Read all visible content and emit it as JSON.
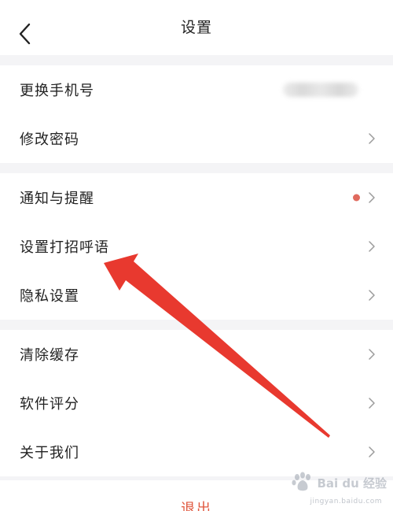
{
  "header": {
    "title": "设置",
    "back_icon": "chevron-left-icon"
  },
  "groups": [
    {
      "items": [
        {
          "label": "更换手机号",
          "value_blurred": true
        },
        {
          "label": "修改密码"
        }
      ]
    },
    {
      "items": [
        {
          "label": "通知与提醒",
          "badge": "red-dot"
        },
        {
          "label": "设置打招呼语"
        },
        {
          "label": "隐私设置"
        }
      ]
    },
    {
      "items": [
        {
          "label": "清除缓存"
        },
        {
          "label": "软件评分"
        },
        {
          "label": "关于我们"
        }
      ]
    }
  ],
  "footer": {
    "logout_label": "退出"
  },
  "annotation": {
    "arrow_color": "#e8392f",
    "points_to": "设置打招呼语"
  },
  "watermark": {
    "brand_text": "Bai du 经验",
    "sub_text": "jingyan.baidu.com"
  },
  "colors": {
    "accent": "#e0583f",
    "dot": "#e06a5e",
    "background": "#f4f4f6"
  }
}
